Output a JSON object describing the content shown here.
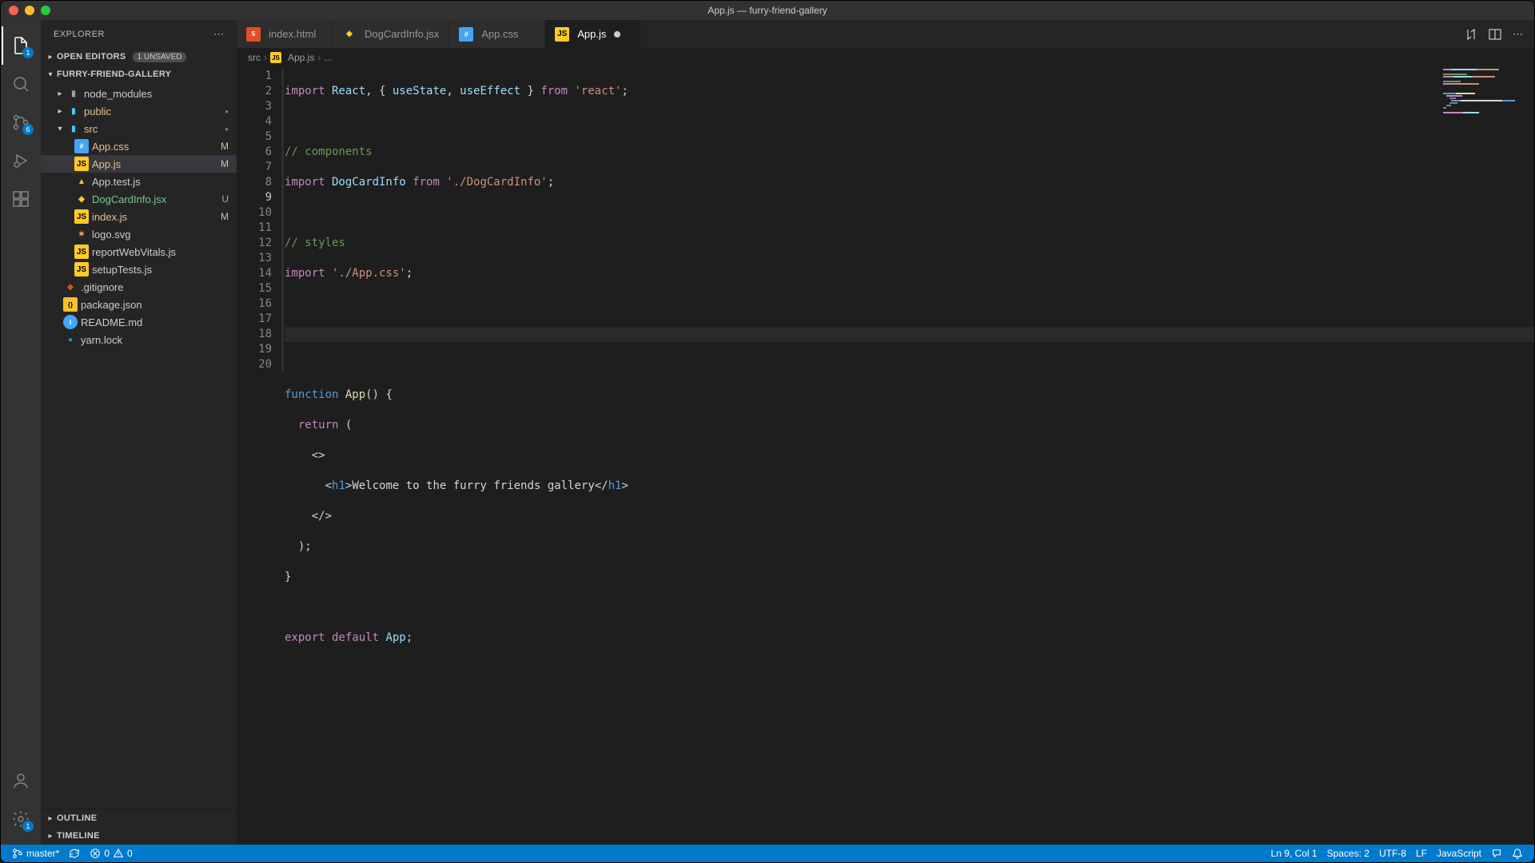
{
  "window": {
    "title": "App.js — furry-friend-gallery"
  },
  "sidebar": {
    "title": "EXPLORER",
    "openEditors": {
      "label": "OPEN EDITORS",
      "badge": "1 UNSAVED"
    },
    "project": {
      "label": "FURRY-FRIEND-GALLERY"
    },
    "outline": {
      "label": "OUTLINE"
    },
    "timeline": {
      "label": "TIMELINE"
    }
  },
  "tree": {
    "node_modules": "node_modules",
    "public": "public",
    "src": "src",
    "appcss": "App.css",
    "appjs": "App.js",
    "apptest": "App.test.js",
    "dogcard": "DogCardInfo.jsx",
    "indexjs": "index.js",
    "logosvg": "logo.svg",
    "reportwv": "reportWebVitals.js",
    "setuptests": "setupTests.js",
    "gitignore": ".gitignore",
    "packagejson": "package.json",
    "readme": "README.md",
    "yarnlock": "yarn.lock",
    "M": "M",
    "U": "U"
  },
  "tabs": [
    {
      "label": "index.html",
      "icon": "html"
    },
    {
      "label": "DogCardInfo.jsx",
      "icon": "jsx"
    },
    {
      "label": "App.css",
      "icon": "css"
    },
    {
      "label": "App.js",
      "icon": "js",
      "active": true,
      "dirty": true
    }
  ],
  "breadcrumbs": {
    "p0": "src",
    "p1": "App.js",
    "p2": "..."
  },
  "activity": {
    "explorer_badge": "1",
    "scm_badge": "6"
  },
  "code": {
    "l1a": "import",
    "l1b": " React",
    "l1c": ", { ",
    "l1d": "useState",
    "l1e": ", ",
    "l1f": "useEffect",
    "l1g": " } ",
    "l1h": "from",
    "l1i": " 'react'",
    "l1j": ";",
    "l3": "// components",
    "l4a": "import",
    "l4b": " DogCardInfo ",
    "l4c": "from",
    "l4d": " './DogCardInfo'",
    "l4e": ";",
    "l6": "// styles",
    "l7a": "import",
    "l7b": " './App.css'",
    "l7c": ";",
    "l11a": "function",
    "l11b": " App",
    "l11c": "() {",
    "l12a": "  return",
    "l12b": " (",
    "l13": "    <>",
    "l14a": "      <",
    "l14b": "h1",
    "l14c": ">",
    "l14d": "Welcome to the furry friends gallery",
    "l14e": "</",
    "l14f": "h1",
    "l14g": ">",
    "l15": "    </>",
    "l16": "  );",
    "l17": "}",
    "l19a": "export",
    "l19b": " default",
    "l19c": " App",
    "l19d": ";"
  },
  "lineNumbers": [
    "1",
    "2",
    "3",
    "4",
    "5",
    "6",
    "7",
    "8",
    "9",
    "10",
    "11",
    "12",
    "13",
    "14",
    "15",
    "16",
    "17",
    "18",
    "19",
    "20"
  ],
  "status": {
    "branch": "master*",
    "errors": "0",
    "warnings": "0",
    "cursor": "Ln 9, Col 1",
    "spaces": "Spaces: 2",
    "encoding": "UTF-8",
    "eol": "LF",
    "lang": "JavaScript"
  }
}
